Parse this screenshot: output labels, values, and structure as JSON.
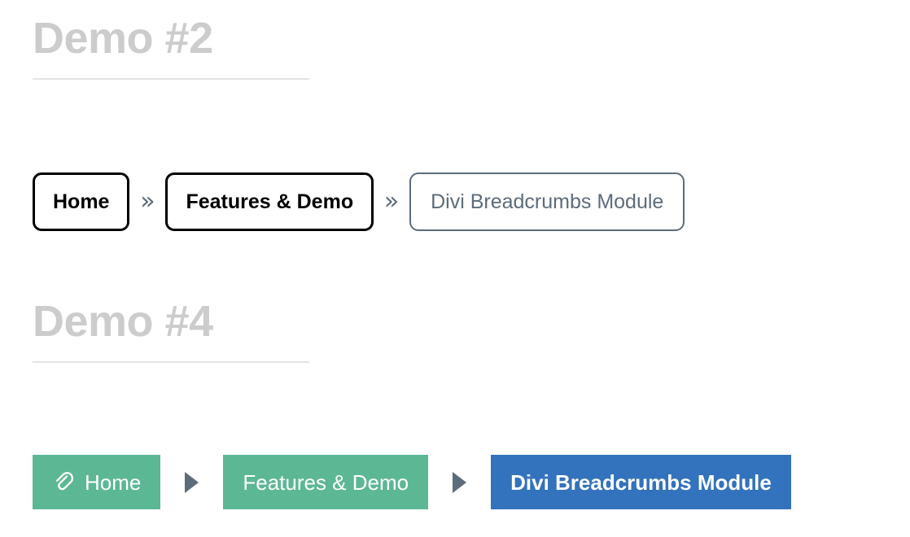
{
  "sections": [
    {
      "heading": "Demo #2",
      "style": "outlined",
      "crumbs": [
        {
          "label": "Home",
          "state": "link",
          "icon": null
        },
        {
          "label": "Features & Demo",
          "state": "link",
          "icon": null
        },
        {
          "label": "Divi Breadcrumbs Module",
          "state": "current",
          "icon": null
        }
      ],
      "separator": "»",
      "separator_icon": "double-chevron-right-icon",
      "colors": {
        "link_border": "#000000",
        "link_text": "#000000",
        "current_border": "#5d6c7b",
        "current_text": "#5d6c7b",
        "separator": "#5d6c7b"
      }
    },
    {
      "heading": "Demo #4",
      "style": "filled",
      "crumbs": [
        {
          "label": "Home",
          "state": "link",
          "icon": "paperclip-icon"
        },
        {
          "label": "Features & Demo",
          "state": "link",
          "icon": null
        },
        {
          "label": "Divi Breadcrumbs Module",
          "state": "current",
          "icon": null
        }
      ],
      "separator": "▶",
      "separator_icon": "triangle-right-icon",
      "colors": {
        "link_bg": "#5cb795",
        "link_text": "#ffffff",
        "current_bg": "#3372bc",
        "current_text": "#ffffff",
        "separator": "#5d6c7b"
      }
    }
  ],
  "theme": {
    "heading_color": "#cccccc",
    "rule_color": "#e4e4e4",
    "page_background": "#ffffff"
  }
}
